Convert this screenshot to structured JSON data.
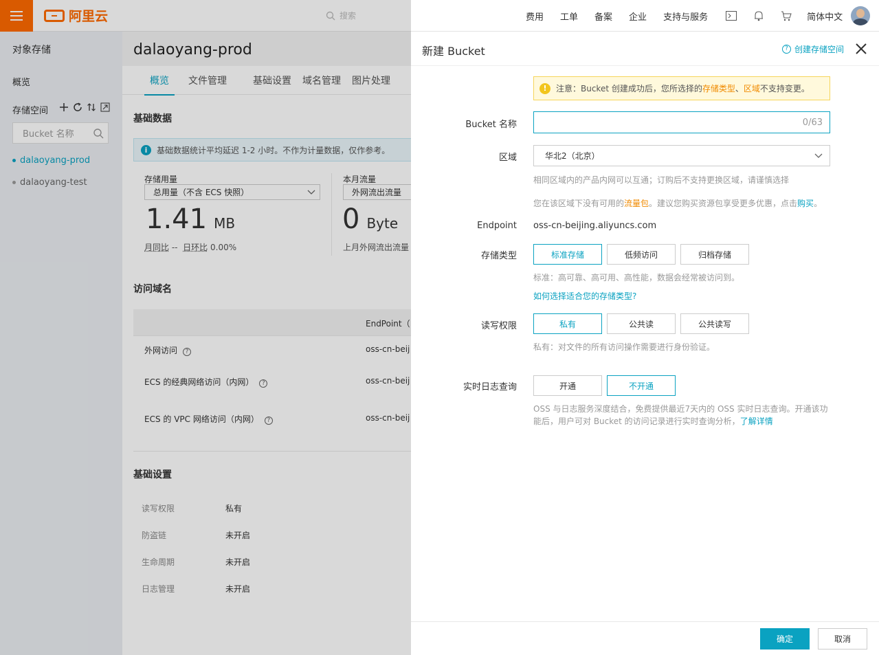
{
  "topbar": {
    "logo": "阿里云",
    "search_placeholder": "搜索",
    "nav": [
      "费用",
      "工单",
      "备案",
      "企业",
      "支持与服务"
    ],
    "language": "简体中文"
  },
  "sidebar": {
    "title": "对象存储",
    "overview": "概览",
    "buckets_label": "存储空间",
    "search_placeholder": "Bucket 名称",
    "buckets": [
      "dalaoyang-prod",
      "dalaoyang-test"
    ]
  },
  "main": {
    "title": "dalaoyang-prod",
    "tabs": [
      "概览",
      "文件管理",
      "基础设置",
      "域名管理",
      "图片处理"
    ],
    "basic_data": "基础数据",
    "info": "基础数据统计平均延迟 1-2 小时。不作为计量数据，仅作参考。",
    "storage_label": "存储用量",
    "storage_select": "总用量（不含 ECS 快照）",
    "storage_value": "1.41",
    "storage_unit": "MB",
    "mom": "月同比",
    "mom_value": "--",
    "dod": "日环比",
    "dod_value": "0.00%",
    "traffic_label": "本月流量",
    "traffic_select": "外网流出流量",
    "traffic_value": "0",
    "traffic_unit": "Byte",
    "traffic_last": "上月外网流出流量",
    "access_domain": "访问域名",
    "endpoint_header": "EndPoint（",
    "rows": [
      {
        "label": "外网访问",
        "value": "oss-cn-beij"
      },
      {
        "label": "ECS 的经典网络访问（内网）",
        "value": "oss-cn-beij"
      },
      {
        "label": "ECS 的 VPC 网络访问（内网）",
        "value": "oss-cn-beij"
      }
    ],
    "basic_settings": "基础设置",
    "settings": [
      {
        "k": "读写权限",
        "v": "私有"
      },
      {
        "k": "防盗链",
        "v": "未开启"
      },
      {
        "k": "生命周期",
        "v": "未开启"
      },
      {
        "k": "日志管理",
        "v": "未开启"
      }
    ]
  },
  "drawer": {
    "title": "新建 Bucket",
    "help": "创建存储空间",
    "warn_prefix": "注意：Bucket 创建成功后，您所选择的",
    "warn_storage": "存储类型",
    "warn_sep": "、",
    "warn_region": "区域",
    "warn_suffix": "不支持变更。",
    "name_label": "Bucket 名称",
    "name_counter": "0/63",
    "region_label": "区域",
    "region_value": "华北2（北京）",
    "region_hint1": "相同区域内的产品内网可以互通；订购后不支持更换区域，请谨慎选择",
    "region_hint2_a": "您在该区域下没有可用的",
    "region_hint2_link": "流量包",
    "region_hint2_b": "。建议您购买资源包享受更多优惠，点击",
    "region_hint2_buy": "购买",
    "region_hint2_end": "。",
    "endpoint_label": "Endpoint",
    "endpoint_value": "oss-cn-beijing.aliyuncs.com",
    "storage_type_label": "存储类型",
    "storage_types": [
      "标准存储",
      "低频访问",
      "归档存储"
    ],
    "storage_hint": "标准：高可靠、高可用、高性能，数据会经常被访问到。",
    "storage_link": "如何选择适合您的存储类型?",
    "acl_label": "读写权限",
    "acl_options": [
      "私有",
      "公共读",
      "公共读写"
    ],
    "acl_hint": "私有：对文件的所有访问操作需要进行身份验证。",
    "log_label": "实时日志查询",
    "log_options": [
      "开通",
      "不开通"
    ],
    "log_hint1": "OSS 与日志服务深度结合，免费提供最近7天内的 OSS 实时日志查询。开通该功",
    "log_hint2": "能后，用户可对 Bucket 的访问记录进行实时查询分析，",
    "log_link": "了解详情",
    "ok": "确定",
    "cancel": "取消"
  }
}
